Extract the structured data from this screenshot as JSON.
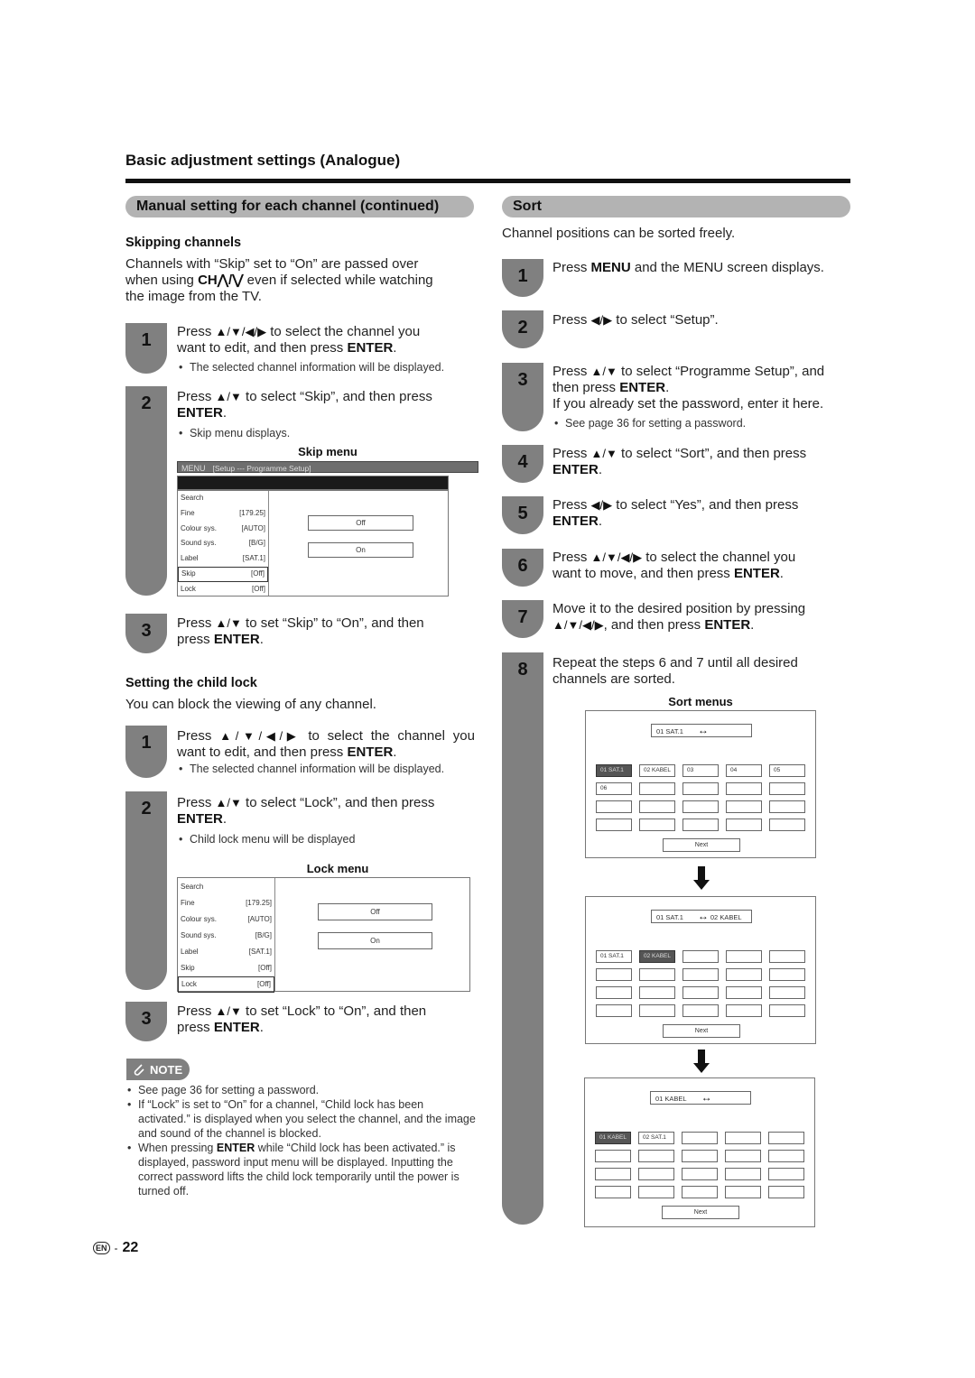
{
  "page": {
    "title": "Basic adjustment settings (Analogue)",
    "language_badge": "EN",
    "separator": "-",
    "page_number": "22"
  },
  "left": {
    "section_title": "Manual setting for each channel (continued)",
    "skipping": {
      "heading": "Skipping channels",
      "intro_1": "Channels with “Skip” set to “On” are passed over",
      "intro_2a": "when using ",
      "intro_2_key": "CH",
      "intro_2_arrows": "⋀/⋁",
      "intro_2b": " even if selected while watching",
      "intro_3": "the image from the TV.",
      "steps": [
        {
          "num": "1",
          "pre": "Press ",
          "arrows": "▲/▼/◀/▶",
          "post": " to select the channel you",
          "line2a": "want to edit, and then press ",
          "line2_key": "ENTER",
          "line2b": ".",
          "bullet": "The selected channel information will be displayed."
        },
        {
          "num": "2",
          "pre": "Press ",
          "arrows": "▲/▼",
          "post": " to select “Skip”, and then press",
          "line2_key": "ENTER",
          "line2b": ".",
          "bullet": "Skip menu displays."
        },
        {
          "num": "3",
          "pre": "Press ",
          "arrows": "▲/▼",
          "post": " to set “Skip” to “On”, and then",
          "line2a": "press ",
          "line2_key": "ENTER",
          "line2b": "."
        }
      ],
      "menu": {
        "caption": "Skip menu",
        "bar_label": "MENU",
        "bar_path": "[Setup --- Programme Setup]",
        "rows": [
          {
            "label": "Search",
            "value": ""
          },
          {
            "label": "Fine",
            "value": "[179.25]"
          },
          {
            "label": "Colour sys.",
            "value": "[AUTO]"
          },
          {
            "label": "Sound sys.",
            "value": "[B/G]"
          },
          {
            "label": "Label",
            "value": "[SAT.1]"
          },
          {
            "label": "Skip",
            "value": "[Off]",
            "selected": true
          },
          {
            "label": "Lock",
            "value": "[Off]"
          }
        ],
        "options": [
          "Off",
          "On"
        ]
      }
    },
    "childlock": {
      "heading": "Setting the child lock",
      "intro": "You can block the viewing of any channel.",
      "steps": [
        {
          "num": "1",
          "pre": "Press ",
          "arrows": "▲/▼/◀/▶",
          "post": " to select the channel you",
          "line2a": "want to edit, and then press ",
          "line2_key": "ENTER",
          "line2b": ".",
          "bullet": "The selected channel information will be displayed."
        },
        {
          "num": "2",
          "pre": "Press ",
          "arrows": "▲/▼",
          "post": " to select “Lock”, and then press",
          "line2_key": "ENTER",
          "line2b": ".",
          "bullet": "Child lock menu will be displayed"
        },
        {
          "num": "3",
          "pre": "Press ",
          "arrows": "▲/▼",
          "post": " to set “Lock” to “On”, and then",
          "line2a": "press ",
          "line2_key": "ENTER",
          "line2b": "."
        }
      ],
      "menu": {
        "caption": "Lock menu",
        "rows": [
          {
            "label": "Search",
            "value": ""
          },
          {
            "label": "Fine",
            "value": "[179.25]"
          },
          {
            "label": "Colour sys.",
            "value": "[AUTO]"
          },
          {
            "label": "Sound sys.",
            "value": "[B/G]"
          },
          {
            "label": "Label",
            "value": "[SAT.1]"
          },
          {
            "label": "Skip",
            "value": "[Off]"
          },
          {
            "label": "Lock",
            "value": "[Off]",
            "selected": true
          }
        ],
        "options": [
          "Off",
          "On"
        ]
      }
    },
    "note": {
      "label": "NOTE",
      "bullets": [
        "See page 36 for setting a password.",
        "If “Lock” is set to “On” for a channel, “Child lock has been activated.” is displayed when you select the channel, and the image and sound of the channel is blocked."
      ],
      "bullet3_pre": "When pressing ",
      "bullet3_key": "ENTER",
      "bullet3_post": " while “Child lock has been activated.” is displayed, password input menu will be displayed. Inputting the correct password lifts the child lock temporarily until the power is turned off."
    }
  },
  "right": {
    "section_title": "Sort",
    "intro": "Channel positions can be sorted freely.",
    "steps": [
      {
        "num": "1",
        "pre": "Press ",
        "key": "MENU",
        "post": " and the MENU screen displays."
      },
      {
        "num": "2",
        "pre": "Press ",
        "arrows": "◀/▶",
        "post": " to select “Setup”."
      },
      {
        "num": "3",
        "pre": "Press ",
        "arrows": "▲/▼",
        "post": " to select “Programme Setup”, and",
        "line2a": "then press ",
        "line2_key": "ENTER",
        "line2b": ".",
        "line3": "If you already set the password, enter it here.",
        "bullet": "See page 36 for setting a password."
      },
      {
        "num": "4",
        "pre": "Press ",
        "arrows": "▲/▼",
        "post": " to select “Sort”, and then press",
        "line2_key": "ENTER",
        "line2b": "."
      },
      {
        "num": "5",
        "pre": "Press ",
        "arrows": "◀/▶",
        "post": " to select “Yes”, and then press",
        "line2_key": "ENTER",
        "line2b": "."
      },
      {
        "num": "6",
        "pre": "Press ",
        "arrows": "▲/▼/◀/▶",
        "post": " to select the channel you",
        "line2a": "want to move, and then press ",
        "line2_key": "ENTER",
        "line2b": "."
      },
      {
        "num": "7",
        "pre": "Move it to the desired position by pressing",
        "line2_arrows": "▲/▼/◀/▶",
        "line2a": ", and then press ",
        "line2_key": "ENTER",
        "line2b": "."
      },
      {
        "num": "8",
        "pre": "Repeat the steps 6 and 7 until all desired",
        "line2a": "channels are sorted."
      }
    ],
    "sort_menus": {
      "caption": "Sort menus",
      "swap_icon": "↔",
      "next_label": "Next",
      "screens": [
        {
          "header_left": "01  SAT.1",
          "header_right": "",
          "cells": [
            "01  SAT.1",
            "02  KABEL",
            "03",
            "04",
            "05",
            "06",
            "",
            "",
            "",
            "",
            "",
            "",
            "",
            "",
            "",
            "",
            "",
            "",
            "",
            ""
          ],
          "highlight": 0
        },
        {
          "header_left": "01  SAT.1",
          "header_right": "02  KABEL",
          "cells": [
            "01  SAT.1",
            "02  KABEL",
            "",
            "",
            "",
            "",
            "",
            "",
            "",
            "",
            "",
            "",
            "",
            "",
            "",
            "",
            "",
            "",
            "",
            ""
          ],
          "highlight": 1
        },
        {
          "header_left": "01  KABEL",
          "header_right": "",
          "cells": [
            "01  KABEL",
            "02  SAT.1",
            "",
            "",
            "",
            "",
            "",
            "",
            "",
            "",
            "",
            "",
            "",
            "",
            "",
            "",
            "",
            "",
            "",
            ""
          ],
          "highlight": 0
        }
      ]
    }
  }
}
